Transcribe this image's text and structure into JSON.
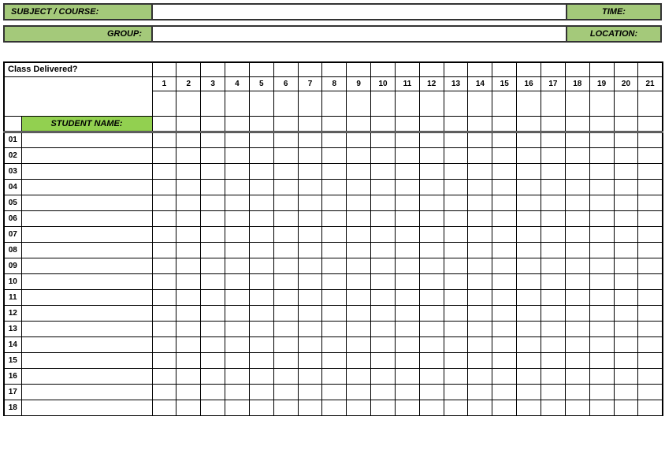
{
  "header": {
    "subject_label": "SUBJECT / COURSE:",
    "subject_value": "",
    "time_label": "TIME:",
    "group_label": "GROUP:",
    "group_value": "",
    "location_label": "LOCATION:"
  },
  "table": {
    "class_delivered_label": "Class Delivered?",
    "student_name_label": "STUDENT NAME:",
    "session_numbers": [
      "1",
      "2",
      "3",
      "4",
      "5",
      "6",
      "7",
      "8",
      "9",
      "10",
      "11",
      "12",
      "13",
      "14",
      "15",
      "16",
      "17",
      "18",
      "19",
      "20",
      "21"
    ],
    "rows": [
      {
        "num": "01",
        "name": ""
      },
      {
        "num": "02",
        "name": ""
      },
      {
        "num": "03",
        "name": ""
      },
      {
        "num": "04",
        "name": ""
      },
      {
        "num": "05",
        "name": ""
      },
      {
        "num": "06",
        "name": ""
      },
      {
        "num": "07",
        "name": ""
      },
      {
        "num": "08",
        "name": ""
      },
      {
        "num": "09",
        "name": ""
      },
      {
        "num": "10",
        "name": ""
      },
      {
        "num": "11",
        "name": ""
      },
      {
        "num": "12",
        "name": ""
      },
      {
        "num": "13",
        "name": ""
      },
      {
        "num": "14",
        "name": ""
      },
      {
        "num": "15",
        "name": ""
      },
      {
        "num": "16",
        "name": ""
      },
      {
        "num": "17",
        "name": ""
      },
      {
        "num": "18",
        "name": ""
      }
    ]
  }
}
